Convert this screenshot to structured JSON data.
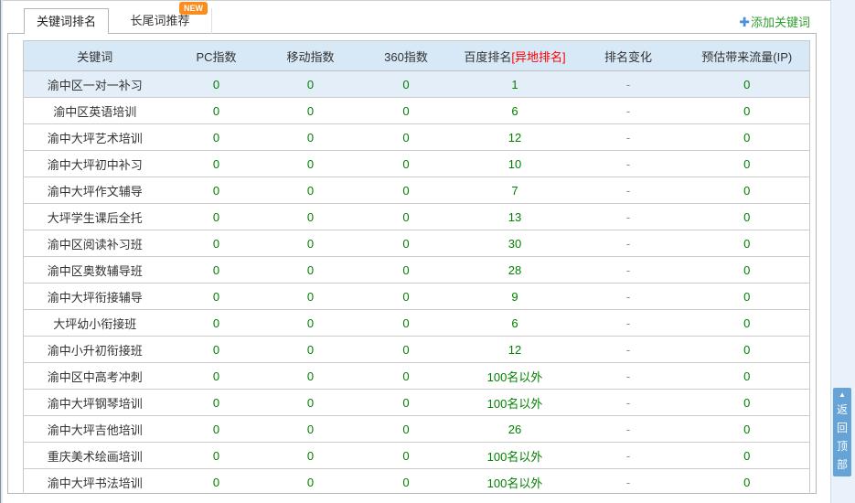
{
  "tabs": [
    {
      "label": "关键词排名",
      "active": true
    },
    {
      "label": "长尾词推荐",
      "active": false,
      "badge": "NEW"
    }
  ],
  "add_keyword": {
    "icon": "plus-icon",
    "glyph": "✚",
    "label": "添加关键词"
  },
  "back_to_top": {
    "icon": "up-arrow-icon",
    "arrow": "▲",
    "label": "返回顶部"
  },
  "table": {
    "headers": {
      "keyword": "关键词",
      "pc_index": "PC指数",
      "mobile_index": "移动指数",
      "index_360": "360指数",
      "baidu_rank": "百度排名",
      "baidu_rank_remote": "[异地排名]",
      "rank_change": "排名变化",
      "est_traffic": "预估带来流量(IP)"
    },
    "rows": [
      {
        "keyword": "渝中区一对一补习",
        "pc_index": "0",
        "mobile_index": "0",
        "index_360": "0",
        "baidu_rank": "1",
        "rank_change": "-",
        "est_traffic": "0",
        "highlighted": true
      },
      {
        "keyword": "渝中区英语培训",
        "pc_index": "0",
        "mobile_index": "0",
        "index_360": "0",
        "baidu_rank": "6",
        "rank_change": "-",
        "est_traffic": "0",
        "highlighted": false
      },
      {
        "keyword": "渝中大坪艺术培训",
        "pc_index": "0",
        "mobile_index": "0",
        "index_360": "0",
        "baidu_rank": "12",
        "rank_change": "-",
        "est_traffic": "0",
        "highlighted": false
      },
      {
        "keyword": "渝中大坪初中补习",
        "pc_index": "0",
        "mobile_index": "0",
        "index_360": "0",
        "baidu_rank": "10",
        "rank_change": "-",
        "est_traffic": "0",
        "highlighted": false
      },
      {
        "keyword": "渝中大坪作文辅导",
        "pc_index": "0",
        "mobile_index": "0",
        "index_360": "0",
        "baidu_rank": "7",
        "rank_change": "-",
        "est_traffic": "0",
        "highlighted": false
      },
      {
        "keyword": "大坪学生课后全托",
        "pc_index": "0",
        "mobile_index": "0",
        "index_360": "0",
        "baidu_rank": "13",
        "rank_change": "-",
        "est_traffic": "0",
        "highlighted": false
      },
      {
        "keyword": "渝中区阅读补习班",
        "pc_index": "0",
        "mobile_index": "0",
        "index_360": "0",
        "baidu_rank": "30",
        "rank_change": "-",
        "est_traffic": "0",
        "highlighted": false
      },
      {
        "keyword": "渝中区奥数辅导班",
        "pc_index": "0",
        "mobile_index": "0",
        "index_360": "0",
        "baidu_rank": "28",
        "rank_change": "-",
        "est_traffic": "0",
        "highlighted": false
      },
      {
        "keyword": "渝中大坪衔接辅导",
        "pc_index": "0",
        "mobile_index": "0",
        "index_360": "0",
        "baidu_rank": "9",
        "rank_change": "-",
        "est_traffic": "0",
        "highlighted": false
      },
      {
        "keyword": "大坪幼小衔接班",
        "pc_index": "0",
        "mobile_index": "0",
        "index_360": "0",
        "baidu_rank": "6",
        "rank_change": "-",
        "est_traffic": "0",
        "highlighted": false
      },
      {
        "keyword": "渝中小升初衔接班",
        "pc_index": "0",
        "mobile_index": "0",
        "index_360": "0",
        "baidu_rank": "12",
        "rank_change": "-",
        "est_traffic": "0",
        "highlighted": false
      },
      {
        "keyword": "渝中区中高考冲刺",
        "pc_index": "0",
        "mobile_index": "0",
        "index_360": "0",
        "baidu_rank": "100名以外",
        "rank_change": "-",
        "est_traffic": "0",
        "highlighted": false
      },
      {
        "keyword": "渝中大坪钢琴培训",
        "pc_index": "0",
        "mobile_index": "0",
        "index_360": "0",
        "baidu_rank": "100名以外",
        "rank_change": "-",
        "est_traffic": "0",
        "highlighted": false
      },
      {
        "keyword": "渝中大坪吉他培训",
        "pc_index": "0",
        "mobile_index": "0",
        "index_360": "0",
        "baidu_rank": "26",
        "rank_change": "-",
        "est_traffic": "0",
        "highlighted": false
      },
      {
        "keyword": "重庆美术绘画培训",
        "pc_index": "0",
        "mobile_index": "0",
        "index_360": "0",
        "baidu_rank": "100名以外",
        "rank_change": "-",
        "est_traffic": "0",
        "highlighted": false
      },
      {
        "keyword": "渝中大坪书法培训",
        "pc_index": "0",
        "mobile_index": "0",
        "index_360": "0",
        "baidu_rank": "100名以外",
        "rank_change": "-",
        "est_traffic": "0",
        "highlighted": false
      }
    ]
  },
  "colors": {
    "green_value": "#008000",
    "green_accent": "#2e9e2e",
    "red_accent": "#ff0000",
    "blue_icon": "#4a90d9",
    "header_bg": "#d7e8f6",
    "row_highlight_bg": "#e3eef9",
    "back_to_top_bg": "#66a3d6",
    "badge_bg": "#fb8c1e",
    "side_strip_bg": "#e9f2fb"
  }
}
